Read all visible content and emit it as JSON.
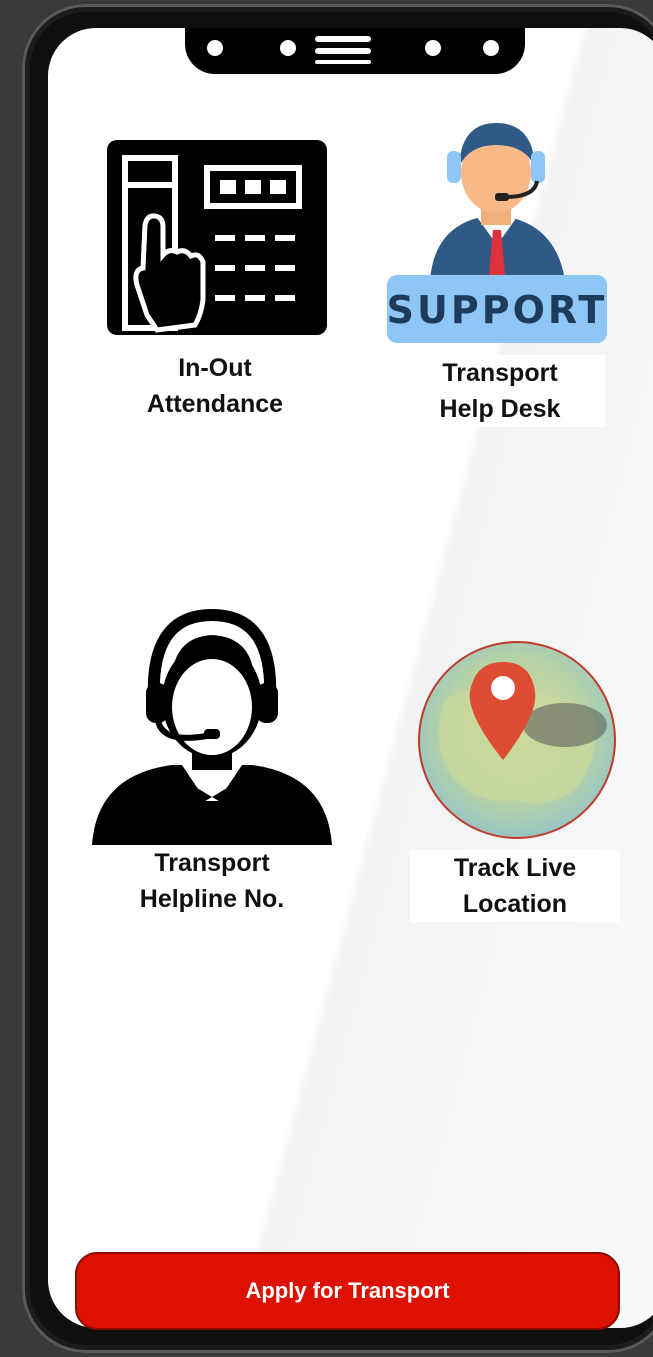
{
  "tiles": [
    {
      "id": "attendance",
      "line1": "In-Out",
      "line2": "Attendance",
      "icon": "attendance-keypad-icon"
    },
    {
      "id": "helpdesk",
      "line1": "Transport",
      "line2": "Help Desk",
      "icon": "support-agent-icon",
      "badge": "SUPPORT"
    },
    {
      "id": "helpline",
      "line1": "Transport",
      "line2": "Helpline No.",
      "icon": "headset-operator-icon"
    },
    {
      "id": "track",
      "line1": "Track Live",
      "line2": "Location",
      "icon": "map-pin-icon"
    }
  ],
  "apply_button": "Apply for Transport",
  "colors": {
    "accent": "#dd1100",
    "support_badge": "#8ec6f5",
    "pin": "#dd4b32",
    "tie": "#e0323c"
  }
}
